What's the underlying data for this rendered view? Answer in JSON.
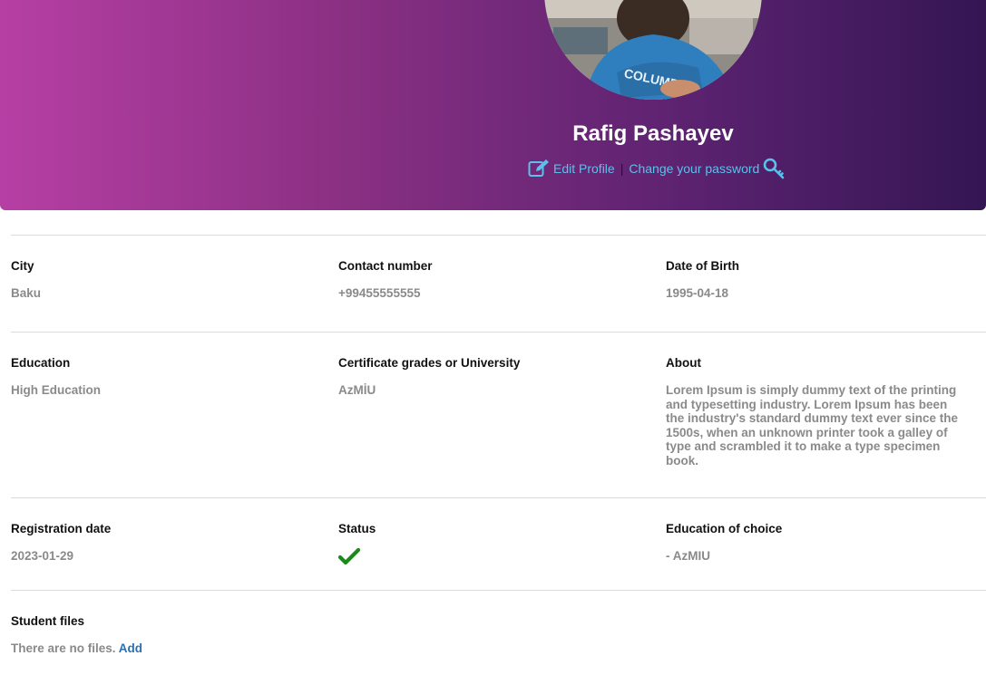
{
  "profile": {
    "name": "Rafig Pashayev",
    "edit_label": "Edit Profile",
    "separator": "|",
    "change_password_label": "Change your password"
  },
  "fields": {
    "city": {
      "label": "City",
      "value": "Baku"
    },
    "contact": {
      "label": "Contact number",
      "value": "+99455555555"
    },
    "dob": {
      "label": "Date of Birth",
      "value": "1995-04-18"
    },
    "education": {
      "label": "Education",
      "value": "High Education"
    },
    "certificate": {
      "label": "Certificate grades or University",
      "value": "AzMİU"
    },
    "about": {
      "label": "About",
      "value": "Lorem Ipsum is simply dummy text of the printing and typesetting industry. Lorem Ipsum has been the industry's standard dummy text ever since the 1500s, when an unknown printer took a galley of type and scrambled it to make a type specimen book."
    },
    "registration": {
      "label": "Registration date",
      "value": "2023-01-29"
    },
    "status": {
      "label": "Status",
      "icon": "check-icon",
      "color": "#1a8a1a"
    },
    "choice": {
      "label": "Education of choice",
      "value": "- AzMIU"
    },
    "files": {
      "label": "Student files",
      "value": "There are no files.",
      "add_label": "Add"
    }
  },
  "colors": {
    "link": "#5bc0eb",
    "muted": "#8a8a8a",
    "add_link": "#2a6fb0",
    "gradient_start": "#b63fa4",
    "gradient_end": "#341653"
  }
}
